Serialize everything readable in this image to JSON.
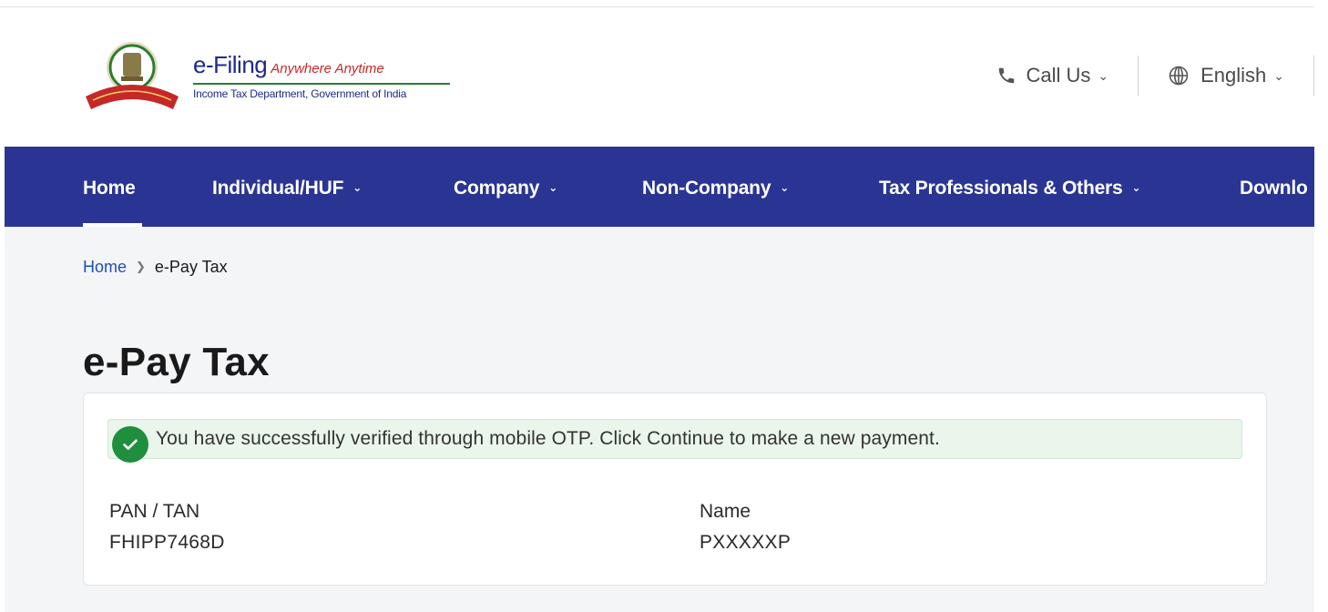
{
  "header": {
    "brand_main": "e-Filing",
    "brand_tagline": "Anywhere Anytime",
    "brand_subtitle": "Income Tax Department, Government of India",
    "call_us": "Call Us",
    "language": "English"
  },
  "nav": {
    "items": [
      {
        "label": "Home",
        "active": true
      },
      {
        "label": "Individual/HUF",
        "dropdown": true
      },
      {
        "label": "Company",
        "dropdown": true
      },
      {
        "label": "Non-Company",
        "dropdown": true
      },
      {
        "label": "Tax Professionals & Others",
        "dropdown": true
      },
      {
        "label": "Downlo"
      }
    ]
  },
  "breadcrumb": {
    "home": "Home",
    "current": "e-Pay Tax"
  },
  "page": {
    "title": "e-Pay Tax"
  },
  "card": {
    "alert": "You have successfully verified through mobile OTP. Click Continue to make a new payment.",
    "pan_label": "PAN / TAN",
    "pan_value": "FHIPP7468D",
    "name_label": "Name",
    "name_value": "PXXXXXP"
  },
  "colors": {
    "nav_background": "#2a3593",
    "brand_blue": "#1f2a8a",
    "success_green": "#1f8e3d",
    "alert_background": "#eaf6ec",
    "link_blue": "#1f4fb5"
  },
  "icons": {
    "phone": "phone-icon",
    "globe": "globe-icon",
    "chevron": "chevron-down-icon",
    "success": "check-circle-icon",
    "emblem": "emblem-icon"
  }
}
